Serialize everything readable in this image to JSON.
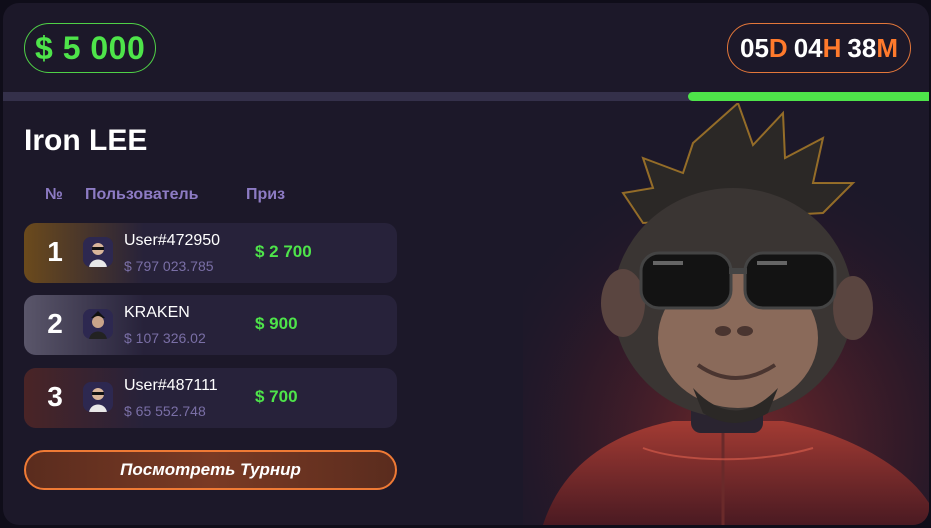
{
  "header": {
    "prize_pool": "$ 5 000",
    "timer": {
      "days": "05",
      "days_unit": "D",
      "hours": "04",
      "hours_unit": "H",
      "minutes": "38",
      "minutes_unit": "M"
    },
    "progress_remaining": 0.26
  },
  "tournament": {
    "title": "Iron LEE"
  },
  "columns": {
    "rank": "№",
    "user": "Пользователь",
    "prize": "Приз"
  },
  "leaderboard": [
    {
      "rank": "1",
      "user": "User#472950",
      "balance": "$ 797 023.785",
      "prize": "$ 2 700"
    },
    {
      "rank": "2",
      "user": "KRAKEN",
      "balance": "$ 107 326.02",
      "prize": "$ 900"
    },
    {
      "rank": "3",
      "user": "User#487111",
      "balance": "$ 65 552.748",
      "prize": "$ 700"
    }
  ],
  "cta": {
    "label": "Посмотреть Турнир"
  },
  "colors": {
    "accent_green": "#4ee44a",
    "accent_orange": "#ff7a2c",
    "background": "#1c1829"
  },
  "icons": {
    "avatar": "user-avatar-icon",
    "hero": "monkey-sunglasses-illustration"
  }
}
